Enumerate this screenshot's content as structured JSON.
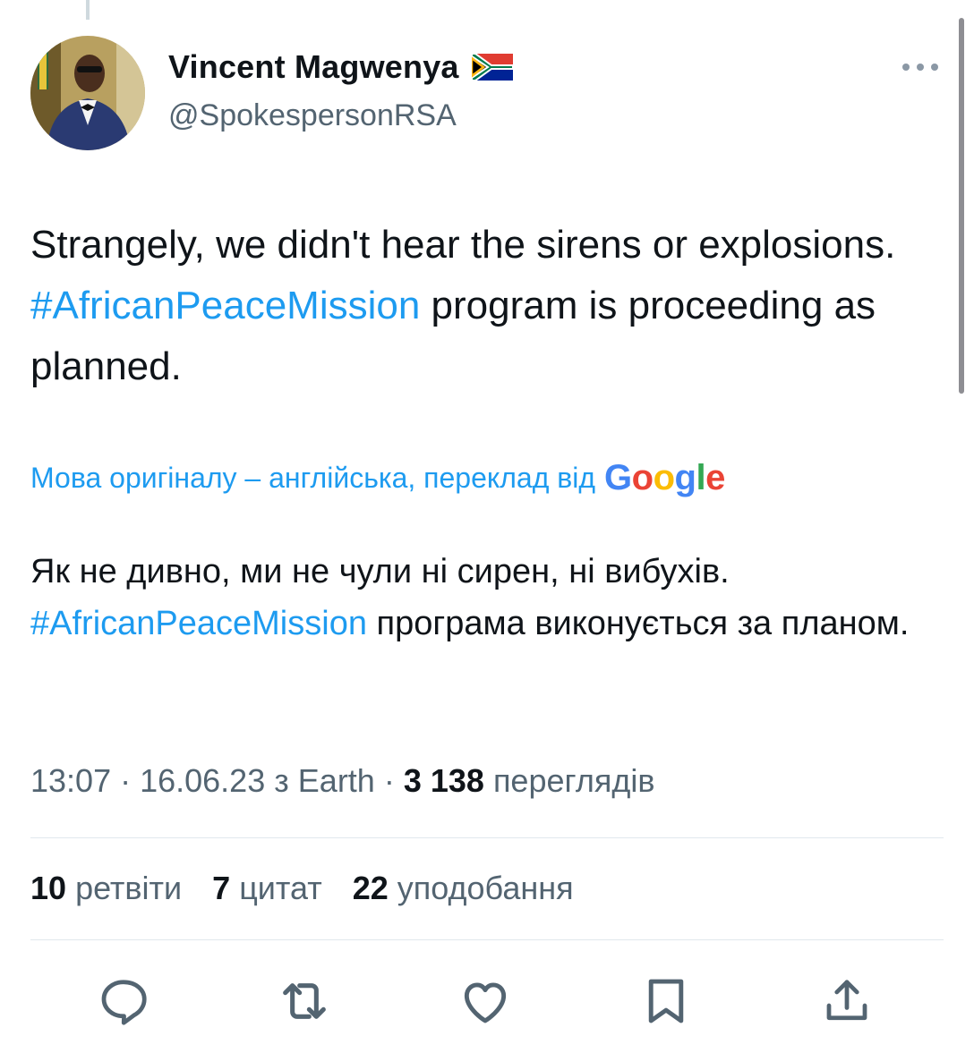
{
  "author": {
    "name": "Vincent Magwenya",
    "handle": "@SpokespersonRSA"
  },
  "tweet": {
    "text_part1": "Strangely, we didn't hear the sirens or explosions. ",
    "hashtag": "#AfricanPeaceMission",
    "text_part2": " program is proceeding as planned."
  },
  "translation": {
    "note": "Мова оригіналу – англійська, переклад від",
    "provider_logo": "Google",
    "text_part1": "Як не дивно, ми не чули ні сирен, ні вибухів. ",
    "hashtag": "#AfricanPeaceMission",
    "text_part2": " програма виконується за планом."
  },
  "meta": {
    "time": "13:07",
    "date": "16.06.23",
    "source_prefix": "з",
    "source": "Earth",
    "views_count": "3 138",
    "views_label": "переглядів"
  },
  "stats": {
    "retweets_count": "10",
    "retweets_label": "ретвіти",
    "quotes_count": "7",
    "quotes_label": "цитат",
    "likes_count": "22",
    "likes_label": "уподобання"
  },
  "icons": [
    "reply-icon",
    "retweet-icon",
    "like-icon",
    "bookmark-icon",
    "share-icon",
    "more-icon",
    "south-africa-flag-icon"
  ],
  "colors": {
    "link": "#1d9bf0",
    "secondary_text": "#536471",
    "primary_text": "#0f1419"
  }
}
